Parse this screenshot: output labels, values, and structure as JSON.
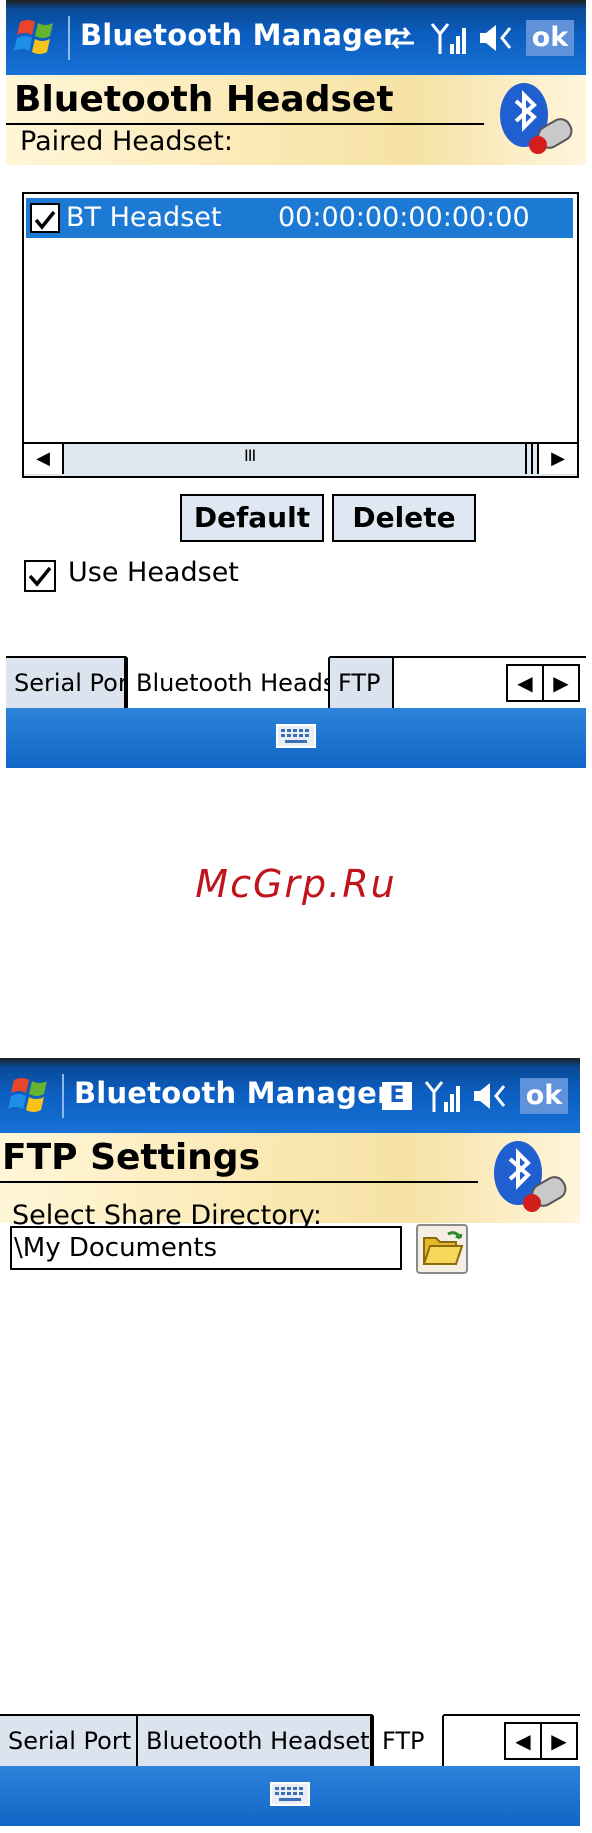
{
  "screen1": {
    "app_title": "Bluetooth Manager",
    "ok_label": "ok",
    "header_title": "Bluetooth Headset",
    "paired_label": "Paired Headset:",
    "list_rows": [
      {
        "name": "BT Headset",
        "address": "00:00:00:00:00:00",
        "checked": true,
        "selected": true
      }
    ],
    "scroll_thumb": "III",
    "default_button": "Default",
    "delete_button": "Delete",
    "use_headset_label": "Use Headset",
    "use_headset_checked": true,
    "tabs": [
      "Serial Port",
      "Bluetooth Headset",
      "FTP"
    ],
    "active_tab": "Bluetooth Headset"
  },
  "watermark": "McGrp.Ru",
  "screen2": {
    "app_title": "Bluetooth Manager",
    "ok_label": "ok",
    "status_badge": "E",
    "header_title": "FTP Settings",
    "share_label": "Select Share Directory:",
    "directory_value": "\\My Documents",
    "tabs": [
      "Serial Port",
      "Bluetooth Headset",
      "FTP"
    ],
    "active_tab": "FTP"
  },
  "icons": {
    "windows_start": "windows-flag-icon",
    "connectivity": "sync-arrows-icon",
    "signal": "signal-strength-icon",
    "volume": "speaker-icon",
    "bluetooth": "bluetooth-headset-icon",
    "keyboard": "keyboard-icon",
    "folder": "open-folder-icon"
  },
  "colors": {
    "titlebar": "#0b5dbf",
    "selection": "#1c7ad4",
    "header_bg": "#fbe9b4",
    "watermark": "#c0141c"
  }
}
